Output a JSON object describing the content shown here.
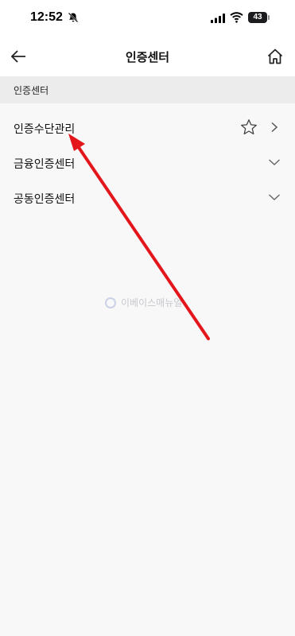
{
  "status_bar": {
    "time": "12:52",
    "battery": "43",
    "icons": [
      "bell-slash-icon",
      "signal-icon",
      "wifi-icon",
      "battery-icon"
    ]
  },
  "nav": {
    "title": "인증센터",
    "back_icon": "arrow-left-icon",
    "home_icon": "home-icon"
  },
  "section": {
    "header": "인증센터"
  },
  "menu": {
    "items": [
      {
        "label": "인증수단관리",
        "icons": [
          "star-icon",
          "chevron-right-icon"
        ]
      },
      {
        "label": "금융인증센터",
        "icons": [
          "chevron-down-icon"
        ]
      },
      {
        "label": "공동인증센터",
        "icons": [
          "chevron-down-icon"
        ]
      }
    ]
  },
  "watermark": {
    "text": "이베이스매뉴얼"
  },
  "colors": {
    "annotation_arrow": "#e3161b",
    "background": "#f8f8f8",
    "section_header_bg": "#ececec"
  }
}
